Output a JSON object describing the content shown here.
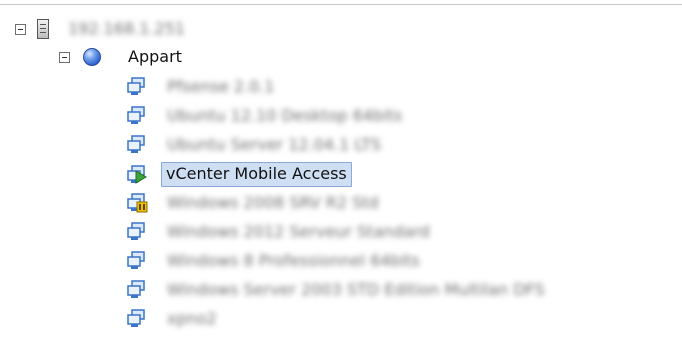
{
  "tree": {
    "host": {
      "label": "192.168.1.251",
      "icon": "server-icon",
      "expanded": true
    },
    "datacenter": {
      "label": "Appart",
      "icon": "datacenter-icon",
      "expanded": true
    },
    "vms": [
      {
        "label": "Pfsense 2.0.1",
        "icon": "vm-icon",
        "state": "normal",
        "blurred": true
      },
      {
        "label": "Ubuntu 12.10 Desktop 64bits",
        "icon": "vm-icon",
        "state": "normal",
        "blurred": true
      },
      {
        "label": "Ubuntu Server 12.04.1 LTS",
        "icon": "vm-icon",
        "state": "normal",
        "blurred": true
      },
      {
        "label": "vCenter Mobile Access",
        "icon": "vm-powered-on-icon",
        "state": "running",
        "blurred": false,
        "selected": true
      },
      {
        "label": "Windows 2008 SRV R2 Std",
        "icon": "vm-warning-icon",
        "state": "warning",
        "blurred": true
      },
      {
        "label": "Windows 2012 Serveur Standard",
        "icon": "vm-icon",
        "state": "normal",
        "blurred": true
      },
      {
        "label": "Windows 8 Professionnel 64bits",
        "icon": "vm-icon",
        "state": "normal",
        "blurred": true
      },
      {
        "label": "Windows Server 2003 STD Edition Multilan DFS",
        "icon": "vm-icon",
        "state": "normal",
        "blurred": true
      },
      {
        "label": "xpno2",
        "icon": "vm-icon",
        "state": "normal",
        "blurred": true
      }
    ]
  },
  "colors": {
    "selection_bg": "#cfdff3",
    "selection_border": "#8aa9d3",
    "vm_blue": "#3b74c9",
    "vm_green": "#3aa63a",
    "warning_yellow": "#f2c200"
  }
}
